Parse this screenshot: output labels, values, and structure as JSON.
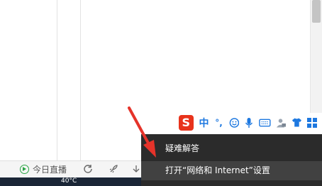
{
  "toolbar": {
    "live_label": "今日直播"
  },
  "taskbar": {
    "weather_temp": "40°C"
  },
  "ime": {
    "logo_letter": "S",
    "chinese_mode": "中",
    "punctuation": "°,",
    "icons": [
      "smiley-icon",
      "microphone-icon",
      "keyboard-icon",
      "user-tools-icon",
      "shirt-icon",
      "grid-icon"
    ]
  },
  "menu": {
    "items": [
      {
        "label": "疑难解答"
      },
      {
        "label": "打开“网络和 Internet”设置"
      }
    ]
  },
  "colors": {
    "ime_blue": "#1d78e0",
    "sogou_red": "#e8331c",
    "menu_bg": "#2b2b2b",
    "arrow_red": "#e5332a"
  }
}
